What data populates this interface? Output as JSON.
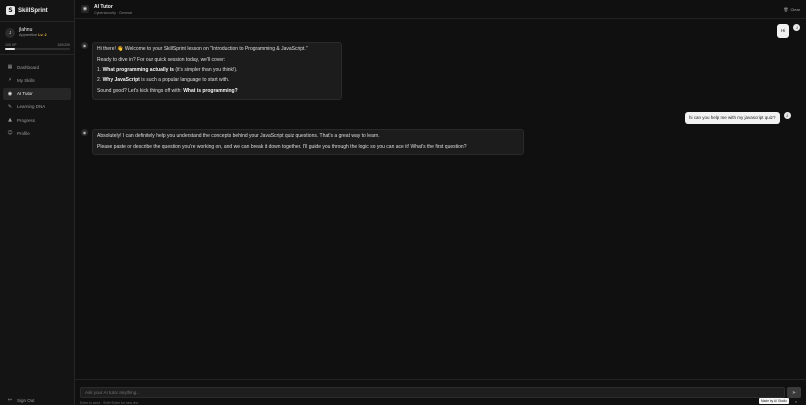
{
  "app": {
    "name": "SkillSprint",
    "logo_glyph": "S"
  },
  "user": {
    "initial": "J",
    "name": "jlahnu",
    "rank": "Apprentice",
    "level": "Lv. 2",
    "xp_left": "100 XP",
    "xp_right": "100/200",
    "xp_progress": 0.15
  },
  "nav": [
    {
      "label": "Dashboard",
      "icon": "grid-icon",
      "glyph": "▦",
      "active": false
    },
    {
      "label": "My Skills",
      "icon": "skills-icon",
      "glyph": "⚡",
      "active": false
    },
    {
      "label": "AI Tutor",
      "icon": "bot-icon",
      "glyph": "◉",
      "active": true
    },
    {
      "label": "Learning DNA",
      "icon": "dna-icon",
      "glyph": "✎",
      "active": false
    },
    {
      "label": "Progress",
      "icon": "chart-icon",
      "glyph": "▲",
      "active": false
    },
    {
      "label": "Profile",
      "icon": "user-icon",
      "glyph": "☺",
      "active": false
    }
  ],
  "signout": {
    "label": "Sign Out",
    "glyph": "↦"
  },
  "header": {
    "title": "AI Tutor",
    "subtitle": "Cybersecurity · General",
    "clear_label": "Clear",
    "clear_glyph": "🗑"
  },
  "messages": {
    "hi": {
      "text": "Hi",
      "avatar": "J"
    },
    "bot1": {
      "intro_pre": "Hi there! 👋 Welcome to your SkillSprint lesson on \"Introduction to Programming & JavaScript.\"",
      "dive": "Ready to dive in? For our quick session today, we'll cover:",
      "item1_num": "1.",
      "item1_bold": "What programming actually is",
      "item1_rest": " (it's simpler than you think!).",
      "item2_num": "2.",
      "item2_bold": "Why JavaScript",
      "item2_rest": " is such a popular language to start with.",
      "closing_pre": "Sound good? Let's kick things off with: ",
      "closing_bold": "What is programming?"
    },
    "user2": {
      "text": "hi can you help me with my javascript quiz?",
      "avatar": "J"
    },
    "bot2": {
      "p1": "Absolutely! I can definitely help you understand the concepts behind your JavaScript quiz questions. That's a great way to learn.",
      "p2": "Please paste or describe the question you're working on, and we can break it down together. I'll guide you through the logic so you can ace it! What's the first question?"
    }
  },
  "input": {
    "placeholder": "Ask your AI tutor anything...",
    "send_glyph": "➤",
    "hint": "Enter to send · Shift+Enter for new line"
  },
  "badge": {
    "text": "Made by AI Studio",
    "close": "×"
  }
}
